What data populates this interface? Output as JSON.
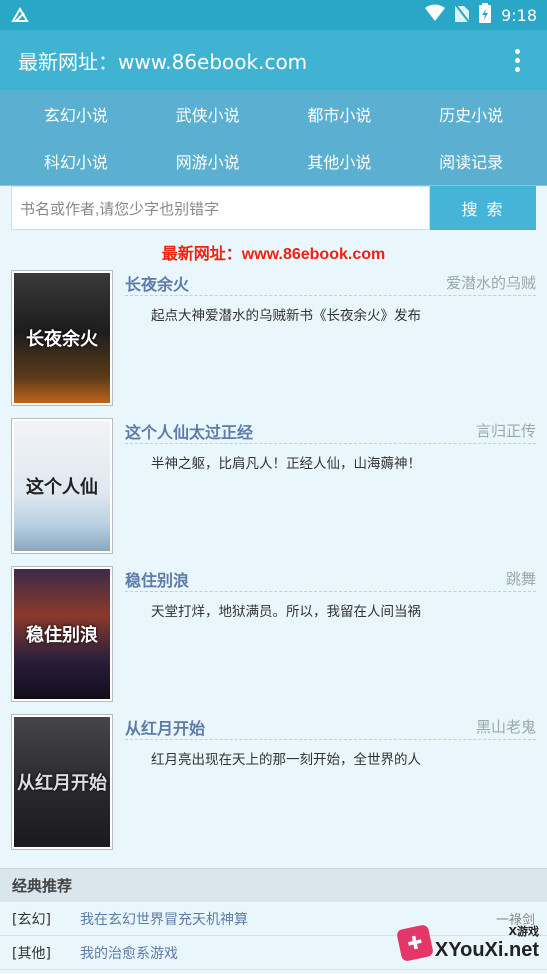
{
  "status_bar": {
    "time": "9:18",
    "icons": [
      "notification-icon",
      "wifi-icon",
      "no-sim-icon",
      "battery-icon"
    ]
  },
  "app_bar": {
    "title": "最新网址：www.86ebook.com",
    "menu_icon": "more-vert-icon"
  },
  "nav": [
    {
      "label": "玄幻小说"
    },
    {
      "label": "武侠小说"
    },
    {
      "label": "都市小说"
    },
    {
      "label": "历史小说"
    },
    {
      "label": "科幻小说"
    },
    {
      "label": "网游小说"
    },
    {
      "label": "其他小说"
    },
    {
      "label": "阅读记录"
    }
  ],
  "search": {
    "placeholder": "书名或作者,请您少字也别错字",
    "button_label": "搜 索"
  },
  "promo": "最新网址：www.86ebook.com",
  "books": [
    {
      "title": "长夜余火",
      "author": "爱潜水的乌贼",
      "desc": "起点大神爱潜水的乌贼新书《长夜余火》发布",
      "cover_text": "长夜余火"
    },
    {
      "title": "这个人仙太过正经",
      "author": "言归正传",
      "desc": "半神之躯，比肩凡人！正经人仙，山海薅神！",
      "cover_text": "这个人仙"
    },
    {
      "title": "稳住别浪",
      "author": "跳舞",
      "desc": "天堂打烊，地狱满员。所以，我留在人间当祸",
      "cover_text": "稳住别浪"
    },
    {
      "title": "从红月开始",
      "author": "黑山老鬼",
      "desc": "红月亮出现在天上的那一刻开始，全世界的人",
      "cover_text": "从红月开始"
    }
  ],
  "classic": {
    "title": "经典推荐",
    "items": [
      {
        "tag": "[玄幻]",
        "name": "我在玄幻世界冒充天机神算",
        "author": "一祿剑"
      },
      {
        "tag": "[其他]",
        "name": "我的治愈系游戏",
        "author": ""
      }
    ]
  },
  "watermark": {
    "small": "X游戏",
    "big": "XYouXi.net"
  }
}
